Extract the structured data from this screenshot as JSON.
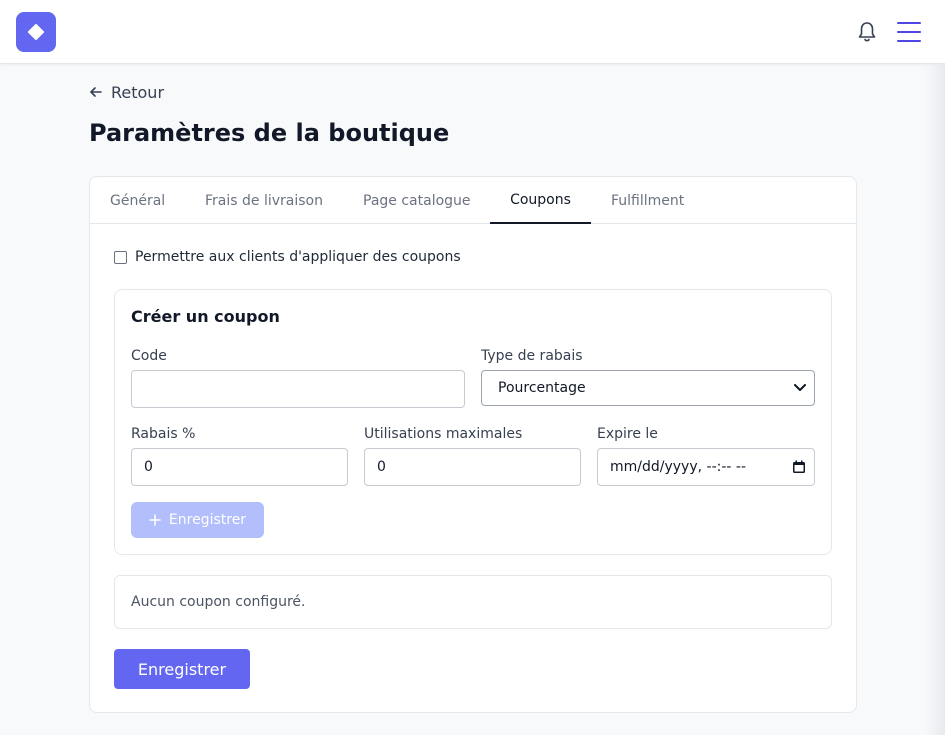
{
  "header": {
    "logo_icon": "diamond-logo-icon",
    "bell_icon": "bell-icon",
    "menu_icon": "hamburger-menu-icon",
    "brand_color": "#6366f1"
  },
  "nav": {
    "back_label": "Retour"
  },
  "page": {
    "title": "Paramètres de la boutique"
  },
  "tabs": [
    {
      "label": "Général"
    },
    {
      "label": "Frais de livraison"
    },
    {
      "label": "Page catalogue"
    },
    {
      "label": "Coupons",
      "active": true
    },
    {
      "label": "Fulfillment"
    }
  ],
  "coupons": {
    "allow_label": "Permettre aux clients d'appliquer des coupons",
    "allow_checked": false,
    "create": {
      "title": "Créer un coupon",
      "code_label": "Code",
      "code_value": "",
      "discount_type_label": "Type de rabais",
      "discount_type_value": "Pourcentage",
      "discount_label": "Rabais %",
      "discount_value": "0",
      "max_uses_label": "Utilisations maximales",
      "max_uses_value": "0",
      "expires_label": "Expire le",
      "expires_placeholder": "mm/dd/yyyy, --:-- --",
      "save_label": "Enregistrer"
    },
    "empty_text": "Aucun coupon configuré.",
    "save_label": "Enregistrer"
  }
}
